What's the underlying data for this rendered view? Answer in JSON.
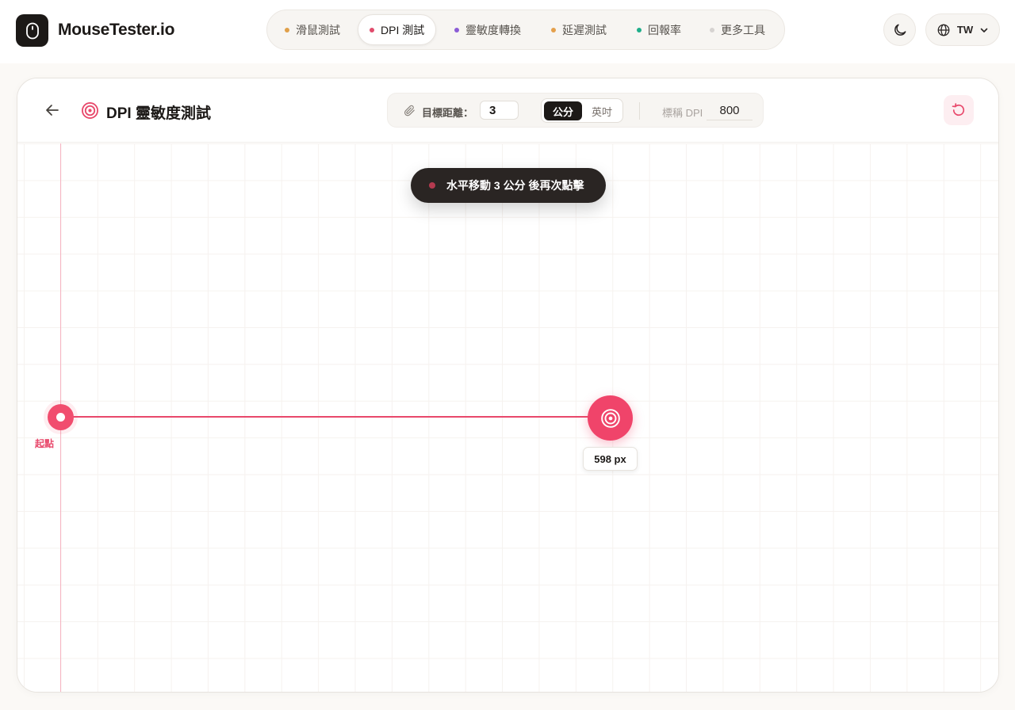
{
  "app": {
    "brand": "MouseTester.io"
  },
  "nav": {
    "items": [
      {
        "label": "滑鼠測試",
        "dot_color": "#e0a04a"
      },
      {
        "label": "DPI 測試",
        "dot_color": "#e14c6c",
        "active": true
      },
      {
        "label": "靈敏度轉換",
        "dot_color": "#8b5cd6"
      },
      {
        "label": "延遲測試",
        "dot_color": "#e4a04c"
      },
      {
        "label": "回報率",
        "dot_color": "#1fae8a"
      },
      {
        "label": "更多工具",
        "dot_color": "#d6d3d1"
      }
    ],
    "theme_icon": "moon-icon",
    "language": "TW"
  },
  "card": {
    "title": "DPI 靈敏度測試",
    "distance_label": "目標距離：",
    "distance_value": "3",
    "units": [
      "公分",
      "英吋"
    ],
    "active_unit": "公分",
    "dpi_label": "標稱 DPI",
    "dpi_value": "800"
  },
  "canvas": {
    "instruction": "水平移動 3 公分 後再次點擊",
    "start_label": "起點",
    "distance_px": "598 px"
  },
  "colors": {
    "accent": "#f0446a",
    "dark": "#1c1917",
    "toast": "#2a2523"
  }
}
